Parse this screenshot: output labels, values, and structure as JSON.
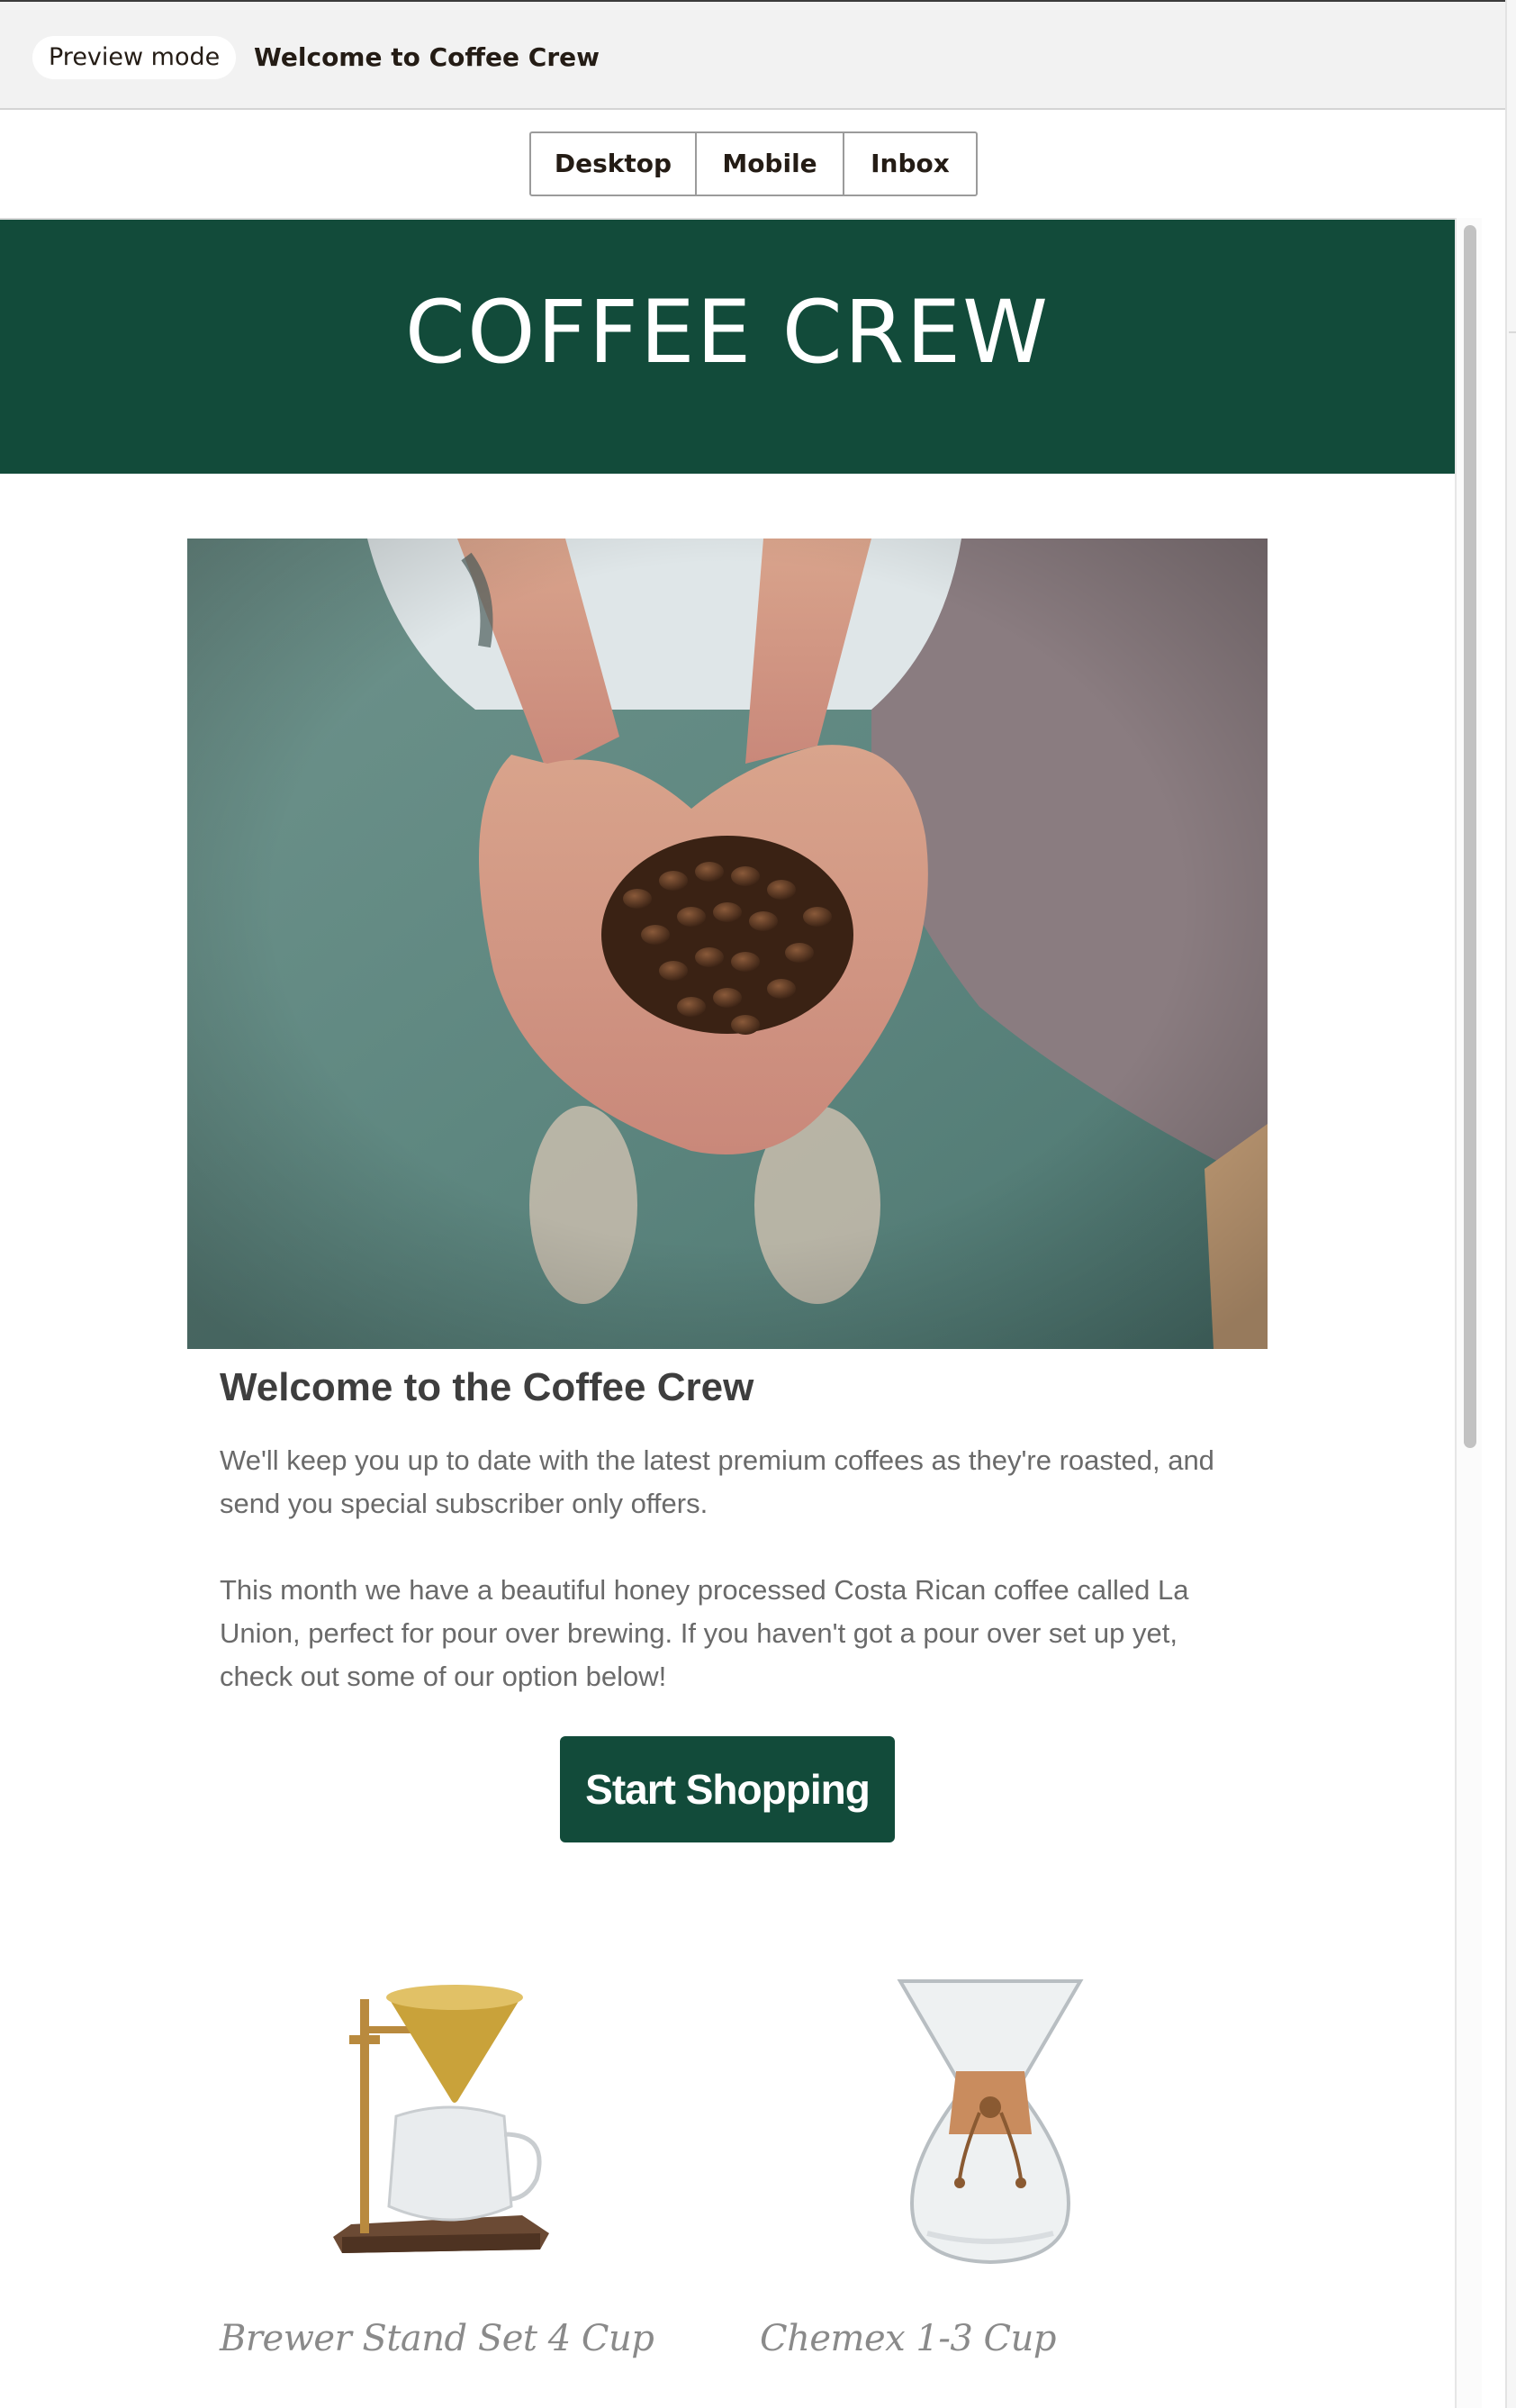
{
  "topbar": {
    "mode_label": "Preview mode",
    "campaign_title": "Welcome to Coffee Crew"
  },
  "view_switcher": {
    "options": [
      "Desktop",
      "Mobile",
      "Inbox"
    ]
  },
  "email": {
    "brand": "COFFEE CREW",
    "brand_color": "#124b3a",
    "hero_image": "coffee beans in cupped hands photo",
    "headline": "Welcome to the Coffee Crew",
    "paragraph_1": "We'll keep you up to date with the latest premium coffees as they're roasted, and send you special subscriber only offers.",
    "paragraph_2": "This month we have a beautiful honey processed Costa Rican coffee called La Union, perfect for pour over brewing. If you haven't got a pour over set up yet, check out some of our option below!",
    "cta_label": "Start Shopping",
    "products": [
      {
        "name": "Brewer Stand Set 4 Cup",
        "image": "brewer-stand-image"
      },
      {
        "name": "Chemex 1-3 Cup",
        "image": "chemex-image"
      }
    ]
  }
}
